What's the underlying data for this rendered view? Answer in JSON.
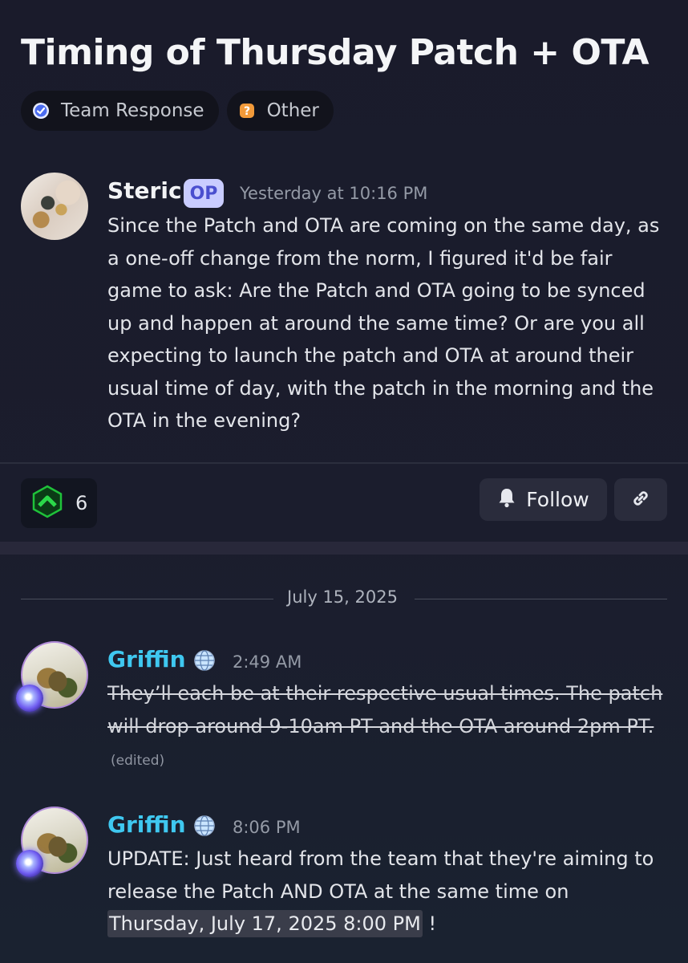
{
  "thread": {
    "title": "Timing of Thursday Patch + OTA",
    "tags": [
      {
        "label": "Team Response",
        "icon": "check-badge-icon"
      },
      {
        "label": "Other",
        "icon": "question-badge-icon"
      }
    ]
  },
  "op_post": {
    "author": "Steric",
    "op_badge": "OP",
    "timestamp": "Yesterday at 10:16 PM",
    "text": "Since the Patch and OTA are coming on the same day, as a one-off change from the norm, I figured it'd be fair game to ask: Are the Patch and OTA going to be synced up and happen at around the same time? Or are you all expecting to launch the patch and OTA at around their usual time of day, with the patch in the morning and the OTA in the evening?",
    "upvote_count": "6",
    "follow_label": "Follow"
  },
  "date_separator": "July 15, 2025",
  "replies": [
    {
      "author": "Griffin",
      "timestamp": "2:49 AM",
      "text": "They’ll each be at their respective usual times. The patch will drop around 9-10am PT and the OTA around 2pm PT.",
      "edited_label": "(edited)"
    },
    {
      "author": "Griffin",
      "timestamp": "8:06 PM",
      "text": "UPDATE: Just heard from the team that they're aiming to release the Patch AND OTA at the same time on ",
      "timestamp_mention": "Thursday, July 17, 2025 8:00 PM",
      "text_end": " !"
    }
  ],
  "colors": {
    "griffin_name": "#3fc8f0",
    "op_badge_bg": "#c9ccff",
    "upvote_green": "#1fc23a"
  }
}
